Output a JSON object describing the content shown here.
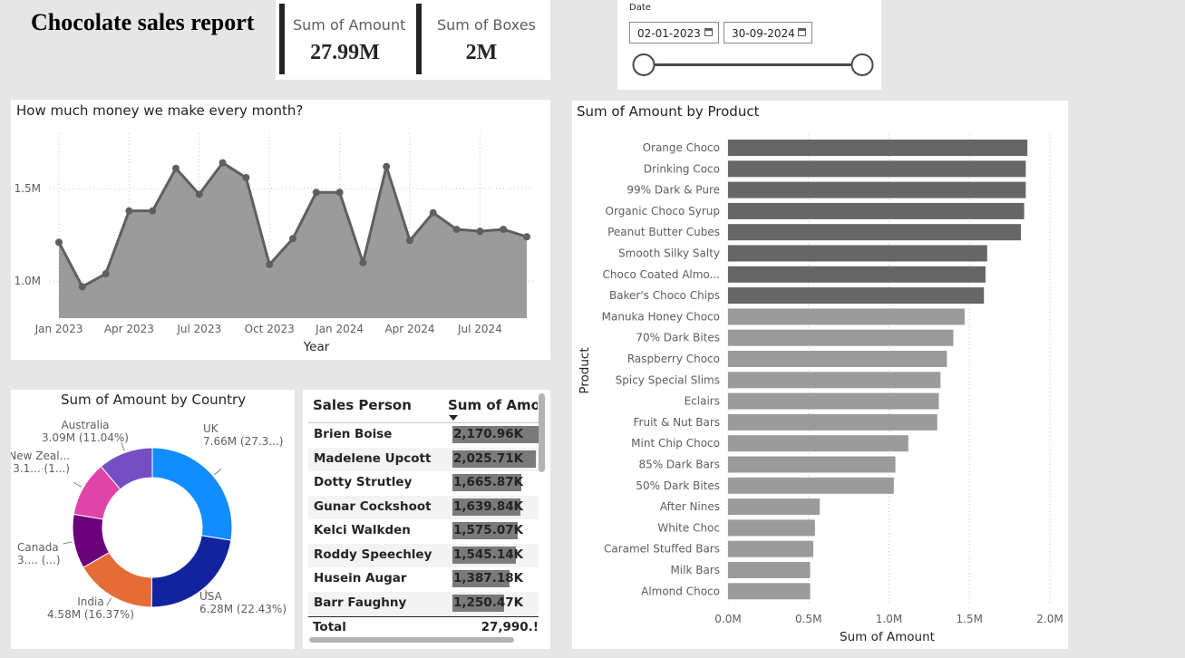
{
  "title": "Chocolate sales report",
  "kpis": [
    {
      "label": "Sum of Amount",
      "value": "27.99M"
    },
    {
      "label": "Sum of Boxes",
      "value": "2M"
    }
  ],
  "date_slicer": {
    "label": "Date",
    "start": "02-01-2023",
    "end": "30-09-2024",
    "start_pos": 0,
    "end_pos": 1
  },
  "colors": {
    "area": "#9b9b9b",
    "line": "#5f5f5f",
    "bar_dark": "#666666",
    "bar_light": "#9b9b9b",
    "table_bar": "#7a7a7a"
  },
  "chart_data": [
    {
      "type": "area",
      "title": "How much money we make every month?",
      "xlabel": "Year",
      "ylabel": "",
      "x_ticks": [
        "Jan 2023",
        "Apr 2023",
        "Jul 2023",
        "Oct 2023",
        "Jan 2024",
        "Apr 2024",
        "Jul 2024"
      ],
      "y_ticks": [
        "1.0M",
        "1.5M"
      ],
      "ylim": [
        0.8,
        1.8
      ],
      "x": [
        "2023-01",
        "2023-02",
        "2023-03",
        "2023-04",
        "2023-05",
        "2023-06",
        "2023-07",
        "2023-08",
        "2023-09",
        "2023-10",
        "2023-11",
        "2023-12",
        "2024-01",
        "2024-02",
        "2024-03",
        "2024-04",
        "2024-05",
        "2024-06",
        "2024-07",
        "2024-08",
        "2024-09"
      ],
      "values": [
        1.21,
        0.97,
        1.04,
        1.38,
        1.38,
        1.61,
        1.47,
        1.64,
        1.56,
        1.09,
        1.23,
        1.48,
        1.48,
        1.1,
        1.62,
        1.22,
        1.37,
        1.28,
        1.27,
        1.28,
        1.24
      ],
      "grid": true
    },
    {
      "type": "pie",
      "title": "Sum of Amount by Country",
      "slices": [
        {
          "label": "UK",
          "value": 7.66,
          "text": "7.66M (27.3...)",
          "color": "#118dff"
        },
        {
          "label": "USA",
          "value": 6.28,
          "text": "6.28M (22.43%)",
          "color": "#12239e"
        },
        {
          "label": "India",
          "value": 4.58,
          "text": "4.58M (16.37%)",
          "color": "#e66c37"
        },
        {
          "label": "Canada",
          "value": 3.06,
          "text": "3.... (...)",
          "color": "#6b007b"
        },
        {
          "label": "New Zeal...",
          "value": 3.12,
          "text": "3.1... (1...)",
          "color": "#e044a7"
        },
        {
          "label": "Australia",
          "value": 3.09,
          "text": "3.09M (11.04%)",
          "color": "#744ec2"
        }
      ]
    },
    {
      "type": "table",
      "columns": [
        "Sales Person",
        "Sum of Amou"
      ],
      "rows": [
        {
          "name": "Brien Boise",
          "value": 2170.96,
          "text": "2,170.96K"
        },
        {
          "name": "Madelene Upcott",
          "value": 2025.71,
          "text": "2,025.71K"
        },
        {
          "name": "Dotty Strutley",
          "value": 1665.87,
          "text": "1,665.87K"
        },
        {
          "name": "Gunar Cockshoot",
          "value": 1639.84,
          "text": "1,639.84K"
        },
        {
          "name": "Kelci Walkden",
          "value": 1575.07,
          "text": "1,575.07K"
        },
        {
          "name": "Roddy Speechley",
          "value": 1545.14,
          "text": "1,545.14K"
        },
        {
          "name": "Husein Augar",
          "value": 1387.18,
          "text": "1,387.18K"
        },
        {
          "name": "Barr Faughny",
          "value": 1250.47,
          "text": "1,250.47K"
        }
      ],
      "total_label": "Total",
      "total_value": "27,990.!",
      "max": 2170.96
    },
    {
      "type": "bar",
      "title": "Sum of Amount by Product",
      "xlabel": "Sum of Amount",
      "ylabel": "Product",
      "xlim": [
        0,
        2.0
      ],
      "x_ticks": [
        "0.0M",
        "0.5M",
        "1.0M",
        "1.5M",
        "2.0M"
      ],
      "categories": [
        "Orange Choco",
        "Drinking Coco",
        "99% Dark & Pure",
        "Organic Choco Syrup",
        "Peanut Butter Cubes",
        "Smooth Silky Salty",
        "Choco Coated Almo...",
        "Baker's Choco Chips",
        "Manuka Honey Choco",
        "70% Dark Bites",
        "Raspberry Choco",
        "Spicy Special Slims",
        "Eclairs",
        "Fruit & Nut Bars",
        "Mint Chip Choco",
        "85% Dark Bars",
        "50% Dark Bites",
        "After Nines",
        "White Choc",
        "Caramel Stuffed Bars",
        "Milk Bars",
        "Almond Choco"
      ],
      "values": [
        1.86,
        1.85,
        1.85,
        1.84,
        1.82,
        1.61,
        1.6,
        1.59,
        1.47,
        1.4,
        1.36,
        1.32,
        1.31,
        1.3,
        1.12,
        1.04,
        1.03,
        0.57,
        0.54,
        0.53,
        0.51,
        0.51
      ],
      "highlight_count": 8
    }
  ]
}
